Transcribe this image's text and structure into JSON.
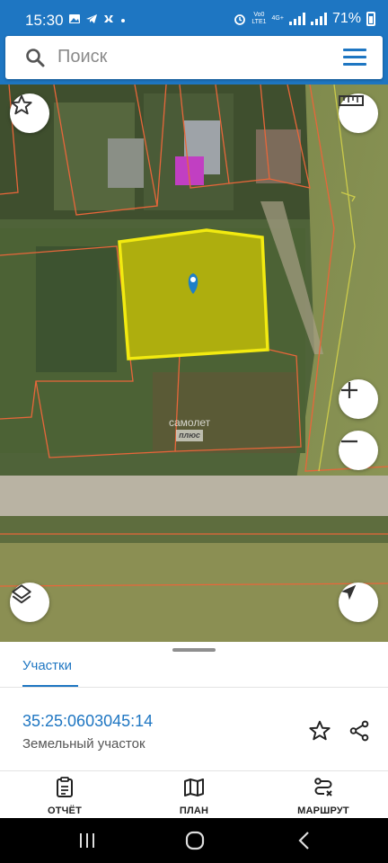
{
  "status_bar": {
    "time": "15:30",
    "notification_icons": [
      "image-icon",
      "telegram-icon",
      "vk-icon",
      "dot-icon"
    ],
    "network_label_top": "Vo0",
    "network_label_bottom": "LTE1",
    "network_type": "4G+",
    "battery": "71%"
  },
  "search": {
    "placeholder": "Поиск",
    "icon": "search-icon",
    "menu_icon": "hamburger-menu-icon"
  },
  "map": {
    "watermark_line1": "самолет",
    "watermark_line2": "плюс",
    "selected_parcel_color": "#e8e000",
    "parcel_border_color": "#e8663a",
    "marker_color": "#1e7fc8",
    "controls": [
      "favorite-star-icon",
      "ruler-icon",
      "zoom-in-icon",
      "zoom-out-icon",
      "layers-icon",
      "locate-arrow-icon"
    ]
  },
  "sheet": {
    "tab_label": "Участки",
    "cadastral_number": "35:25:0603045:14",
    "parcel_type": "Земельный участок",
    "actions": [
      {
        "label": "ОТЧЁТ",
        "icon": "report-clipboard-icon"
      },
      {
        "label": "ПЛАН",
        "icon": "map-plan-icon"
      },
      {
        "label": "МАРШРУТ",
        "icon": "route-icon"
      }
    ]
  },
  "colors": {
    "accent": "#1e76c2"
  }
}
